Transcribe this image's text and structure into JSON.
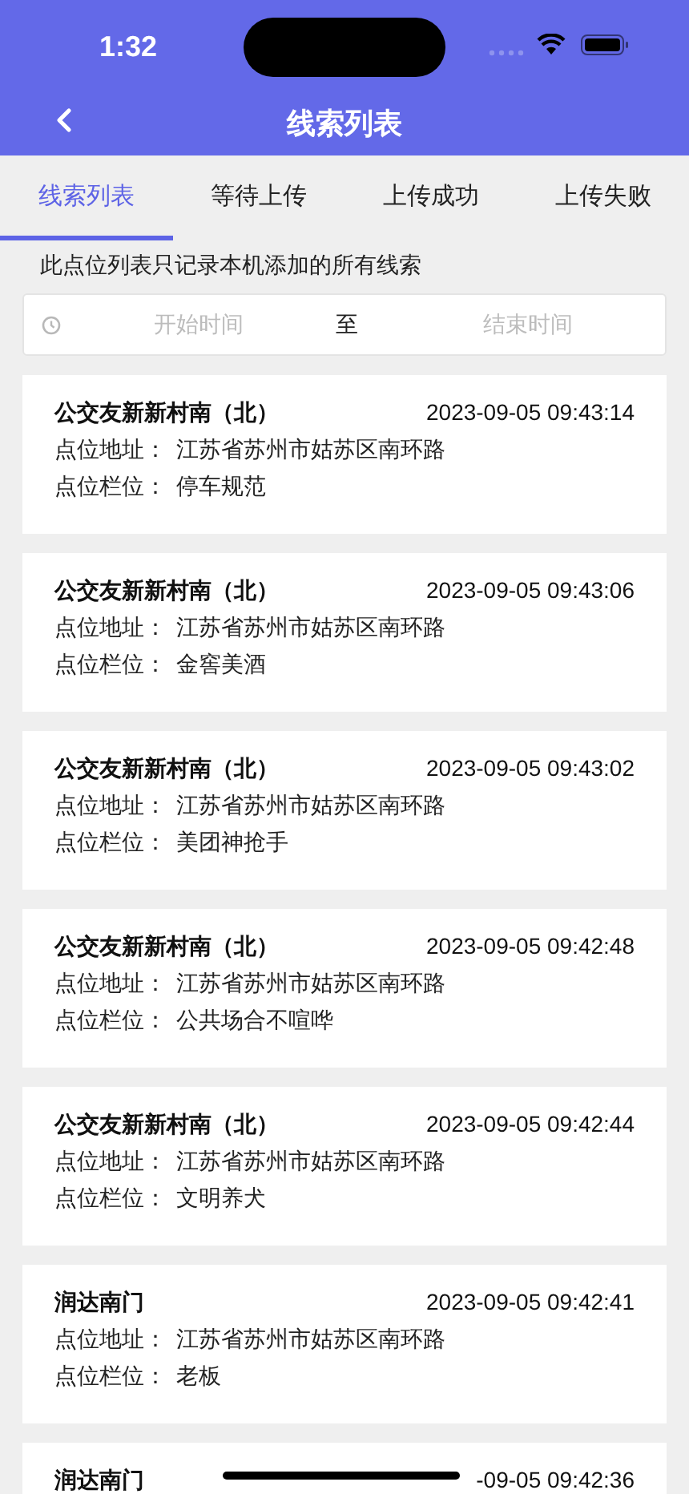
{
  "status_bar": {
    "time": "1:32"
  },
  "header": {
    "title": "线索列表"
  },
  "tabs": [
    {
      "label": "线索列表",
      "selected": true
    },
    {
      "label": "等待上传",
      "selected": false
    },
    {
      "label": "上传成功",
      "selected": false
    },
    {
      "label": "上传失败",
      "selected": false
    }
  ],
  "note": "此点位列表只记录本机添加的所有线索",
  "date_range": {
    "start_placeholder": "开始时间",
    "separator": "至",
    "end_placeholder": "结束时间"
  },
  "records": [
    {
      "name": "公交友新新村南（北）",
      "time": "2023-09-05 09:43:14",
      "address_label": "点位地址：",
      "address": "江苏省苏州市姑苏区南环路",
      "column_label": "点位栏位：",
      "column": "停车规范"
    },
    {
      "name": "公交友新新村南（北）",
      "time": "2023-09-05 09:43:06",
      "address_label": "点位地址：",
      "address": "江苏省苏州市姑苏区南环路",
      "column_label": "点位栏位：",
      "column": "金窖美酒"
    },
    {
      "name": "公交友新新村南（北）",
      "time": "2023-09-05 09:43:02",
      "address_label": "点位地址：",
      "address": "江苏省苏州市姑苏区南环路",
      "column_label": "点位栏位：",
      "column": "美团神抢手"
    },
    {
      "name": "公交友新新村南（北）",
      "time": "2023-09-05 09:42:48",
      "address_label": "点位地址：",
      "address": "江苏省苏州市姑苏区南环路",
      "column_label": "点位栏位：",
      "column": "公共场合不喧哗"
    },
    {
      "name": "公交友新新村南（北）",
      "time": "2023-09-05 09:42:44",
      "address_label": "点位地址：",
      "address": "江苏省苏州市姑苏区南环路",
      "column_label": "点位栏位：",
      "column": "文明养犬"
    },
    {
      "name": "润达南门",
      "time": "2023-09-05 09:42:41",
      "address_label": "点位地址：",
      "address": "江苏省苏州市姑苏区南环路",
      "column_label": "点位栏位：",
      "column": "老板"
    },
    {
      "name": "润达南门",
      "time": "-09-05 09:42:36"
    }
  ]
}
